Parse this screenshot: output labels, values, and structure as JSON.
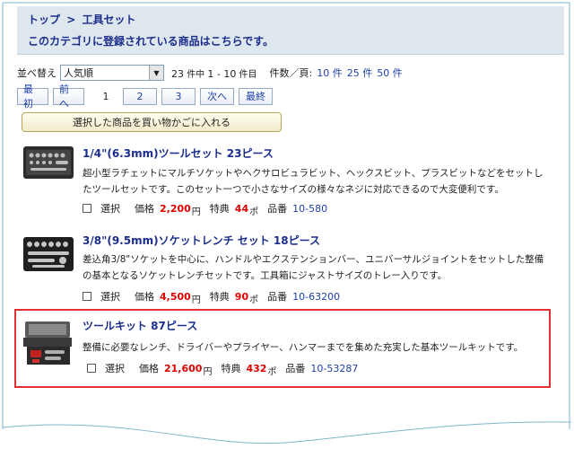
{
  "breadcrumb": {
    "home": "トップ",
    "separator": ">",
    "current": "工具セット"
  },
  "subtitle": "このカテゴリに登録されている商品はこちらです。",
  "sort": {
    "label": "並べ替え",
    "selected": "人気順",
    "count_total": "23",
    "count_mid": "件中",
    "count_range": "1 - 10",
    "count_end": "件目",
    "per_page_label": "件数／頁:",
    "per_page_options": [
      "10 件",
      "25 件",
      "50 件"
    ]
  },
  "pager": {
    "first": "最初",
    "prev": "前へ",
    "current": "1",
    "pages": [
      "2",
      "3"
    ],
    "next": "次へ",
    "last": "最終"
  },
  "cart_button": "選択した商品を買い物かごに入れる",
  "labels": {
    "select": "選択",
    "price": "価格",
    "yen": "円",
    "bonus": "特典",
    "pt": "ポ",
    "code": "品番"
  },
  "products": [
    {
      "title": "1/4\"(6.3mm)ツールセット 23ピース",
      "desc": "超小型ラチェットにマルチソケットやヘクサロビュラビット、ヘックスビット、プラスビットなどをセットしたツールセットです。このセット一つで小さなサイズの様々なネジに対応できるので大変便利です。",
      "price": "2,200",
      "bonus": "44",
      "code": "10-580"
    },
    {
      "title": "3/8\"(9.5mm)ソケットレンチ セット 18ピース",
      "desc": "差込角3/8\"ソケットを中心に、ハンドルやエクステンションバー、ユニバーサルジョイントをセットした整備の基本となるソケットレンチセットです。工具箱にジャストサイズのトレー入りです。",
      "price": "4,500",
      "bonus": "90",
      "code": "10-63200"
    },
    {
      "title": "ツールキット 87ピース",
      "desc": "整備に必要なレンチ、ドライバーやプライヤー、ハンマーまでを集めた充実した基本ツールキットです。",
      "price": "21,600",
      "bonus": "432",
      "code": "10-53287"
    }
  ],
  "colors": {
    "accent": "#1a2d8c",
    "price": "#e00000",
    "highlight": "#e53030",
    "header_bg": "#dfe7ee"
  }
}
